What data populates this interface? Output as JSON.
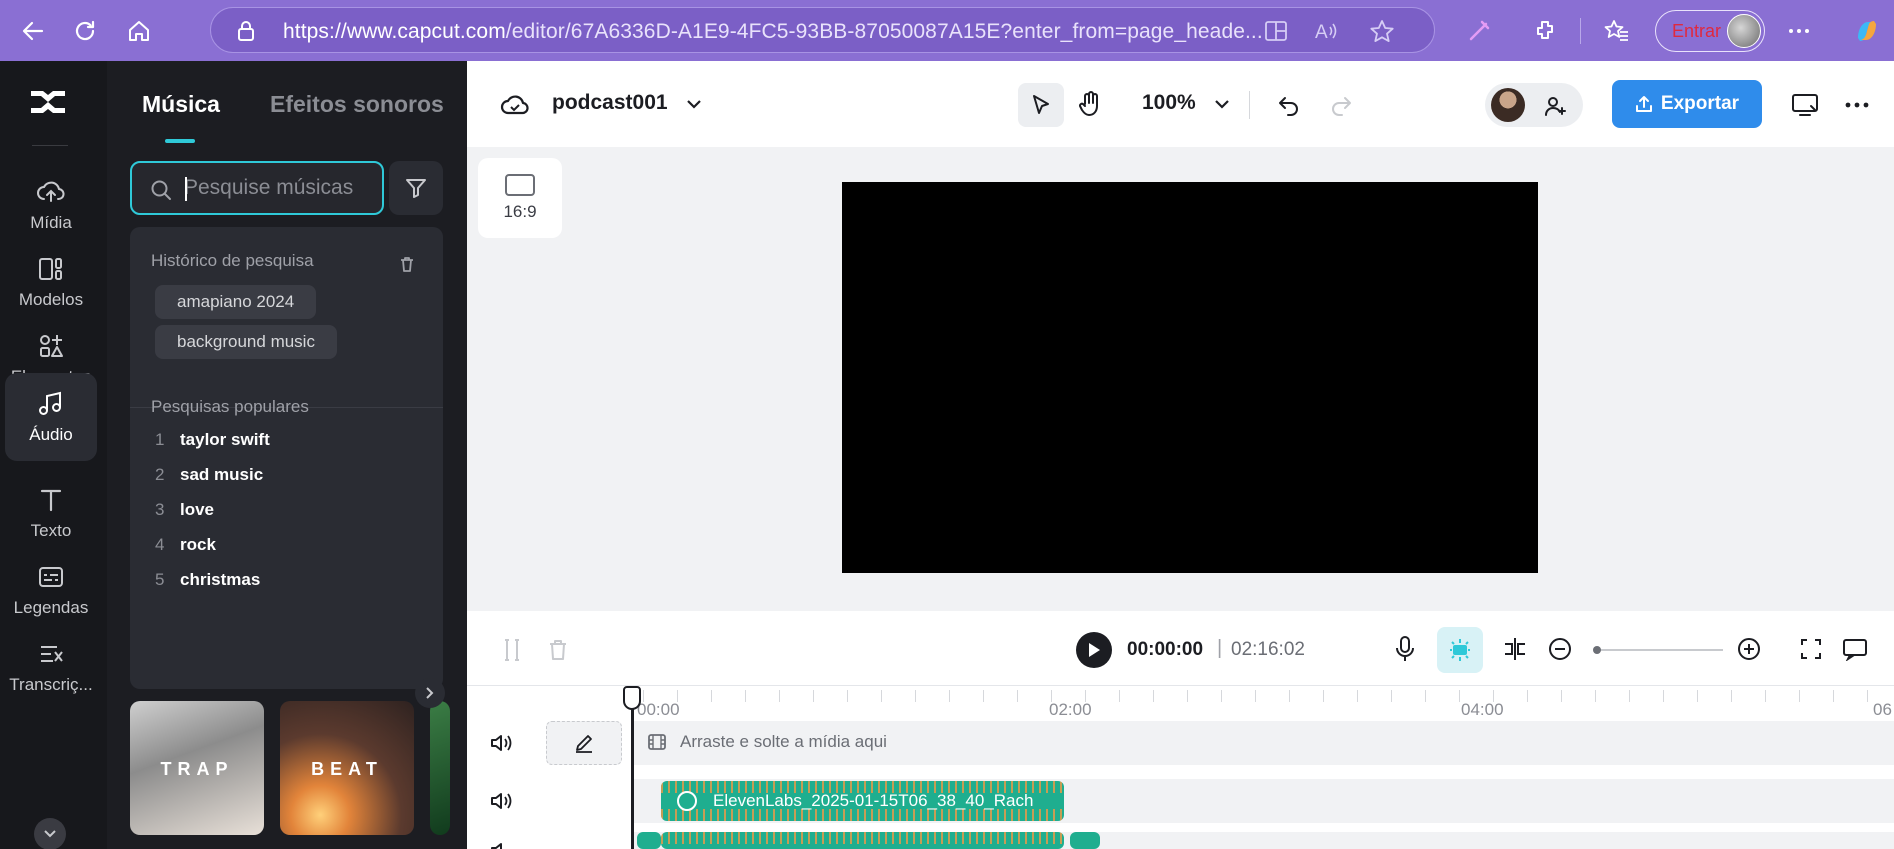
{
  "browser": {
    "url_host": "https://www.capcut.com",
    "url_path": "/editor/67A6336D-A1E9-4FC5-93BB-87050087A15E?enter_from=page_heade...",
    "signin_label": "Entrar"
  },
  "rail": {
    "items": [
      {
        "label": "Mídia",
        "icon": "cloud-upload-icon"
      },
      {
        "label": "Modelos",
        "icon": "templates-icon"
      },
      {
        "label": "Elementos",
        "icon": "elements-icon"
      },
      {
        "label": "Áudio",
        "icon": "music-note-icon"
      },
      {
        "label": "Texto",
        "icon": "text-icon"
      },
      {
        "label": "Legendas",
        "icon": "captions-icon"
      },
      {
        "label": "Transcriç...",
        "icon": "transcript-icon"
      }
    ],
    "active": "Áudio"
  },
  "panel": {
    "tabs": [
      {
        "label": "Música"
      },
      {
        "label": "Efeitos sonoros"
      }
    ],
    "search": {
      "placeholder": "Pesquise músicas",
      "value": ""
    },
    "history": {
      "heading": "Histórico de pesquisa",
      "items": [
        "amapiano 2024",
        "background music"
      ]
    },
    "popular": {
      "heading": "Pesquisas populares",
      "items": [
        {
          "rank": "1",
          "term": "taylor swift"
        },
        {
          "rank": "2",
          "term": "sad music"
        },
        {
          "rank": "3",
          "term": "love"
        },
        {
          "rank": "4",
          "term": "rock"
        },
        {
          "rank": "5",
          "term": "christmas"
        }
      ]
    },
    "thumbnails": [
      {
        "label": "TRAP"
      },
      {
        "label": "BEAT"
      }
    ]
  },
  "topbar": {
    "project_name": "podcast001",
    "zoom": "100%",
    "export_label": "Exportar"
  },
  "canvas": {
    "ratio_label": "16:9"
  },
  "timeline": {
    "current_time": "00:00:00",
    "separator": "|",
    "total_time": "02:16:02",
    "ruler": [
      "00:00",
      "02:00",
      "04:00",
      "06"
    ],
    "drop_hint": "Arraste e solte a mídia aqui",
    "clip_label": "ElevenLabs_2025-01-15T06_38_40_Rach"
  },
  "colors": {
    "accent": "#2fc9d8",
    "export": "#2f8ceb",
    "browser": "#8a6fd3",
    "clip": "#1fae8f"
  }
}
